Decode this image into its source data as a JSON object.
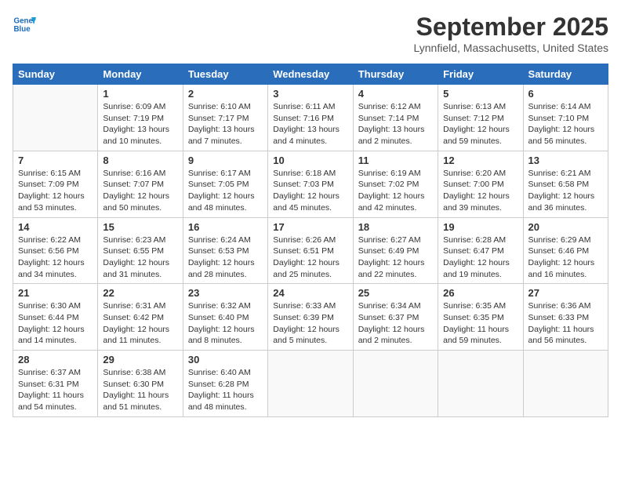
{
  "header": {
    "logo_line1": "General",
    "logo_line2": "Blue",
    "month": "September 2025",
    "location": "Lynnfield, Massachusetts, United States"
  },
  "weekdays": [
    "Sunday",
    "Monday",
    "Tuesday",
    "Wednesday",
    "Thursday",
    "Friday",
    "Saturday"
  ],
  "weeks": [
    [
      {
        "day": "",
        "info": ""
      },
      {
        "day": "1",
        "info": "Sunrise: 6:09 AM\nSunset: 7:19 PM\nDaylight: 13 hours\nand 10 minutes."
      },
      {
        "day": "2",
        "info": "Sunrise: 6:10 AM\nSunset: 7:17 PM\nDaylight: 13 hours\nand 7 minutes."
      },
      {
        "day": "3",
        "info": "Sunrise: 6:11 AM\nSunset: 7:16 PM\nDaylight: 13 hours\nand 4 minutes."
      },
      {
        "day": "4",
        "info": "Sunrise: 6:12 AM\nSunset: 7:14 PM\nDaylight: 13 hours\nand 2 minutes."
      },
      {
        "day": "5",
        "info": "Sunrise: 6:13 AM\nSunset: 7:12 PM\nDaylight: 12 hours\nand 59 minutes."
      },
      {
        "day": "6",
        "info": "Sunrise: 6:14 AM\nSunset: 7:10 PM\nDaylight: 12 hours\nand 56 minutes."
      }
    ],
    [
      {
        "day": "7",
        "info": "Sunrise: 6:15 AM\nSunset: 7:09 PM\nDaylight: 12 hours\nand 53 minutes."
      },
      {
        "day": "8",
        "info": "Sunrise: 6:16 AM\nSunset: 7:07 PM\nDaylight: 12 hours\nand 50 minutes."
      },
      {
        "day": "9",
        "info": "Sunrise: 6:17 AM\nSunset: 7:05 PM\nDaylight: 12 hours\nand 48 minutes."
      },
      {
        "day": "10",
        "info": "Sunrise: 6:18 AM\nSunset: 7:03 PM\nDaylight: 12 hours\nand 45 minutes."
      },
      {
        "day": "11",
        "info": "Sunrise: 6:19 AM\nSunset: 7:02 PM\nDaylight: 12 hours\nand 42 minutes."
      },
      {
        "day": "12",
        "info": "Sunrise: 6:20 AM\nSunset: 7:00 PM\nDaylight: 12 hours\nand 39 minutes."
      },
      {
        "day": "13",
        "info": "Sunrise: 6:21 AM\nSunset: 6:58 PM\nDaylight: 12 hours\nand 36 minutes."
      }
    ],
    [
      {
        "day": "14",
        "info": "Sunrise: 6:22 AM\nSunset: 6:56 PM\nDaylight: 12 hours\nand 34 minutes."
      },
      {
        "day": "15",
        "info": "Sunrise: 6:23 AM\nSunset: 6:55 PM\nDaylight: 12 hours\nand 31 minutes."
      },
      {
        "day": "16",
        "info": "Sunrise: 6:24 AM\nSunset: 6:53 PM\nDaylight: 12 hours\nand 28 minutes."
      },
      {
        "day": "17",
        "info": "Sunrise: 6:26 AM\nSunset: 6:51 PM\nDaylight: 12 hours\nand 25 minutes."
      },
      {
        "day": "18",
        "info": "Sunrise: 6:27 AM\nSunset: 6:49 PM\nDaylight: 12 hours\nand 22 minutes."
      },
      {
        "day": "19",
        "info": "Sunrise: 6:28 AM\nSunset: 6:47 PM\nDaylight: 12 hours\nand 19 minutes."
      },
      {
        "day": "20",
        "info": "Sunrise: 6:29 AM\nSunset: 6:46 PM\nDaylight: 12 hours\nand 16 minutes."
      }
    ],
    [
      {
        "day": "21",
        "info": "Sunrise: 6:30 AM\nSunset: 6:44 PM\nDaylight: 12 hours\nand 14 minutes."
      },
      {
        "day": "22",
        "info": "Sunrise: 6:31 AM\nSunset: 6:42 PM\nDaylight: 12 hours\nand 11 minutes."
      },
      {
        "day": "23",
        "info": "Sunrise: 6:32 AM\nSunset: 6:40 PM\nDaylight: 12 hours\nand 8 minutes."
      },
      {
        "day": "24",
        "info": "Sunrise: 6:33 AM\nSunset: 6:39 PM\nDaylight: 12 hours\nand 5 minutes."
      },
      {
        "day": "25",
        "info": "Sunrise: 6:34 AM\nSunset: 6:37 PM\nDaylight: 12 hours\nand 2 minutes."
      },
      {
        "day": "26",
        "info": "Sunrise: 6:35 AM\nSunset: 6:35 PM\nDaylight: 11 hours\nand 59 minutes."
      },
      {
        "day": "27",
        "info": "Sunrise: 6:36 AM\nSunset: 6:33 PM\nDaylight: 11 hours\nand 56 minutes."
      }
    ],
    [
      {
        "day": "28",
        "info": "Sunrise: 6:37 AM\nSunset: 6:31 PM\nDaylight: 11 hours\nand 54 minutes."
      },
      {
        "day": "29",
        "info": "Sunrise: 6:38 AM\nSunset: 6:30 PM\nDaylight: 11 hours\nand 51 minutes."
      },
      {
        "day": "30",
        "info": "Sunrise: 6:40 AM\nSunset: 6:28 PM\nDaylight: 11 hours\nand 48 minutes."
      },
      {
        "day": "",
        "info": ""
      },
      {
        "day": "",
        "info": ""
      },
      {
        "day": "",
        "info": ""
      },
      {
        "day": "",
        "info": ""
      }
    ]
  ]
}
